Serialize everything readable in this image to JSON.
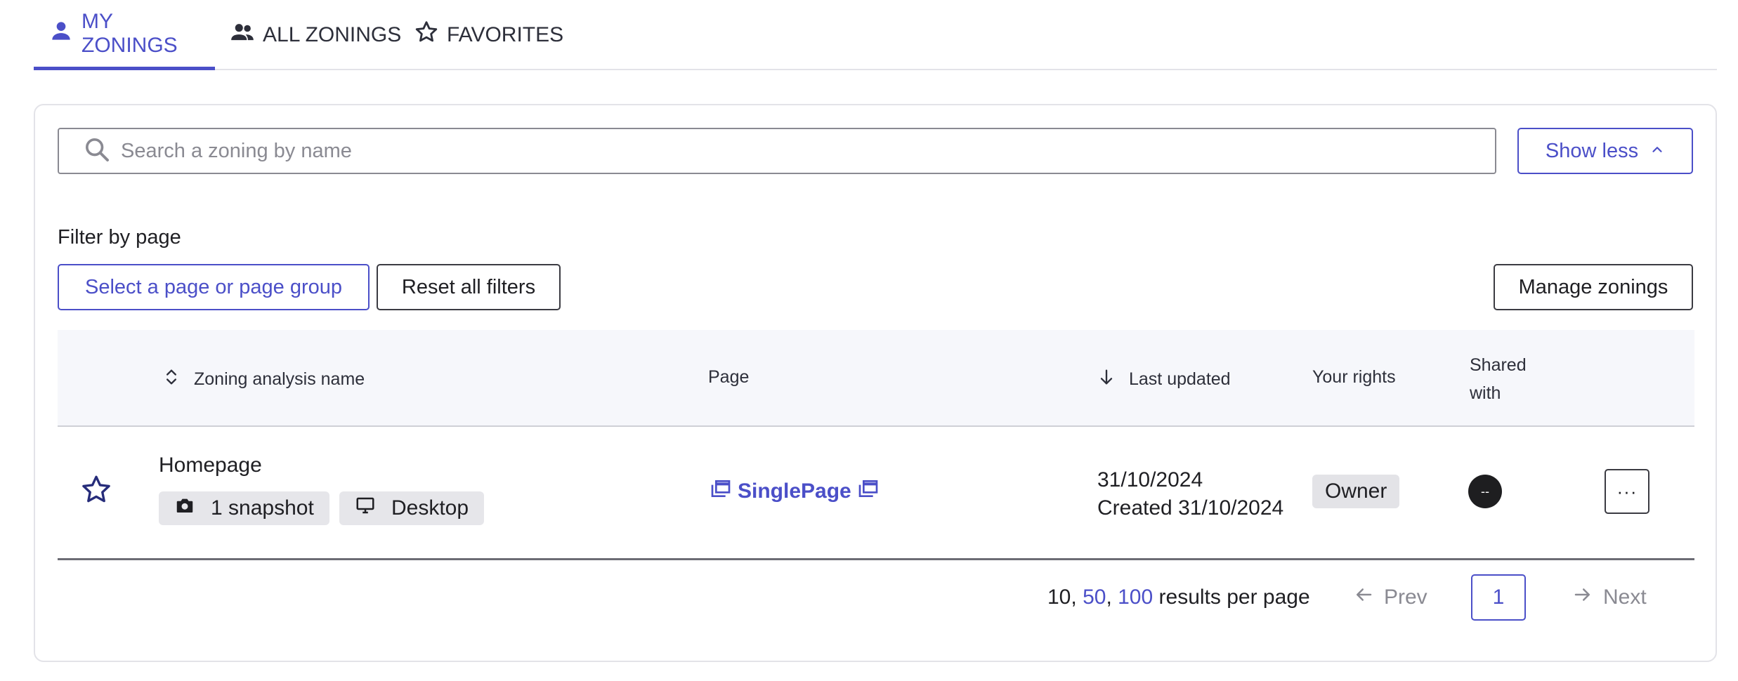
{
  "tabs": [
    {
      "label": "MY ZONINGS",
      "icon": "user-icon",
      "active": true
    },
    {
      "label": "ALL ZONINGS",
      "icon": "users-icon",
      "active": false
    },
    {
      "label": "FAVORITES",
      "icon": "star-icon",
      "active": false
    }
  ],
  "search": {
    "placeholder": "Search a zoning by name",
    "value": ""
  },
  "toggle": {
    "label": "Show less"
  },
  "filter": {
    "label": "Filter by page",
    "select_label": "Select a page or page group",
    "reset_label": "Reset all filters",
    "manage_label": "Manage zonings"
  },
  "table": {
    "headers": {
      "name": "Zoning analysis name",
      "page": "Page",
      "updated": "Last updated",
      "rights": "Your rights",
      "shared_line1": "Shared",
      "shared_line2": "with"
    },
    "rows": [
      {
        "name": "Homepage",
        "snapshot": "1 snapshot",
        "device": "Desktop",
        "page": "SinglePage",
        "updated": "31/10/2024",
        "created": "Created 31/10/2024",
        "rights": "Owner",
        "shared": "--",
        "more": "···"
      }
    ]
  },
  "pagination": {
    "rpp_selected": "10",
    "rpp_options": [
      "50",
      "100"
    ],
    "sep": ",",
    "rpp_suffix": "results per page",
    "prev": "Prev",
    "next": "Next",
    "current": "1"
  },
  "colors": {
    "accent": "#4b4fc8",
    "text": "#1f1f23",
    "muted": "#8a8a92",
    "header_bg": "#f6f7fb"
  }
}
